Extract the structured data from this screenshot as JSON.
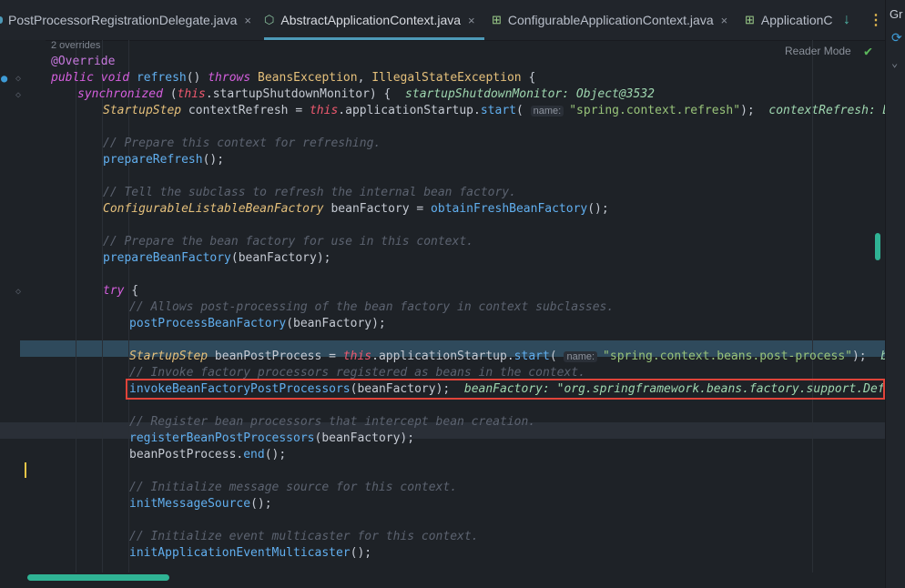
{
  "tabs": [
    {
      "label": "PostProcessorRegistrationDelegate.java",
      "close": "×"
    },
    {
      "label": "AbstractApplicationContext.java",
      "close": "×"
    },
    {
      "label": "ConfigurableApplicationContext.java",
      "close": "×"
    },
    {
      "label": "ApplicationC"
    }
  ],
  "toolbar": {
    "reader_mode": "Reader Mode",
    "right_label": "Gr"
  },
  "editor": {
    "overrides": "2 overrides",
    "annotation": "@Override",
    "l_public": "public",
    "l_void": "void",
    "l_refresh": "refresh",
    "l_throws": "throws",
    "l_beans_ex": "BeansException",
    "l_illegal_ex": "IllegalStateException",
    "l_sync": "synchronized",
    "l_this": "this",
    "l_monitor": ".startupShutdownMonitor) {",
    "l_monitor_hint": "startupShutdownMonitor: Object@3532",
    "l_step_type": "StartupStep",
    "l_ctxrefresh": "contextRefresh",
    "l_appstart": ".applicationStartup.",
    "l_start": "start",
    "l_name_hint": "name:",
    "l_str_refresh": "\"spring.context.refresh\"",
    "l_ctxrefresh_hint": "contextRefresh: DefaultApp",
    "c_prepare": "// Prepare this context for refreshing.",
    "f_prepareRefresh": "prepareRefresh",
    "c_tell": "// Tell the subclass to refresh the internal bean factory.",
    "t_clbf": "ConfigurableListableBeanFactory",
    "v_beanFactory": "beanFactory",
    "f_obtain": "obtainFreshBeanFactory",
    "c_prepare_bf": "// Prepare the bean factory for use in this context.",
    "f_prepareBF": "prepareBeanFactory",
    "k_try": "try",
    "c_allows": "// Allows post-processing of the bean factory in context subclasses.",
    "f_postProcessBF": "postProcessBeanFactory",
    "v_beanPostProcess": "beanPostProcess",
    "s_post_process": "\"spring.context.beans.post-process\"",
    "h_bpp": "beanPostPr",
    "c_invoke": "// Invoke factory processors registered as beans in the context.",
    "f_invoke": "invokeBeanFactoryPostProcessors",
    "h_bf": "beanFactory: \"org.springframework.beans.factory.support.DefaultLista",
    "c_register": "// Register bean processors that intercept bean creation.",
    "f_register": "registerBeanPostProcessors",
    "f_end": "end",
    "c_init_msg": "// Initialize message source for this context.",
    "f_initMsg": "initMessageSource",
    "c_init_evt": "// Initialize event multicaster for this context.",
    "f_initEvt": "initApplicationEventMulticaster"
  },
  "colors": {
    "accent": "#4d9ab8",
    "highlight_box": "#e0443a",
    "scroll": "#2fb394"
  }
}
